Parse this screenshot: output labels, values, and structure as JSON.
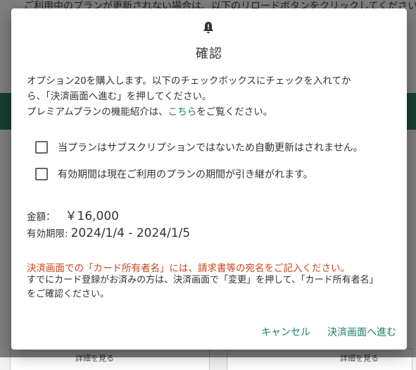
{
  "background": {
    "top_text": "ご利用中のプランが更新されない場合は、以下のリロードボタンをクリックしてください",
    "card_left_label": "詳細を見る",
    "card_right_label": "詳細を見る"
  },
  "dialog": {
    "icon": "bell-icon",
    "title": "確認",
    "intro_line1": "オプション20を購入します。以下のチェックボックスにチェックを入れてか",
    "intro_line2": "ら、「決済画面へ進む」を押してください。",
    "intro_line3_before": "プレミアムプランの機能紹介は、",
    "intro_link": "こちら",
    "intro_line3_after": "をご覧ください。",
    "checkbox1_label": "当プランはサブスクリプションではないため自動更新はされません。",
    "checkbox1_checked": false,
    "checkbox2_label": "有効期間は現在ご利用のプランの期間が引き継がれます。",
    "checkbox2_checked": false,
    "price_label": "金額：",
    "price_value": "￥16,000",
    "period_label": "有効期限:",
    "period_value": "2024/1/4 - 2024/1/5",
    "warning": "決済画面での「カード所有者名」には、請求書等の宛名をご記入ください。",
    "note_line1": "すでにカード登録がお済みの方は、決済画面で「変更」を押して、「カード所有者名」",
    "note_line2": "をご確認ください。",
    "cancel_label": "キャンセル",
    "proceed_label": "決済画面へ進む"
  },
  "colors": {
    "accent": "#1a7f68",
    "warning": "#c9451a",
    "overlay": "rgba(0,0,0,0.5)"
  }
}
